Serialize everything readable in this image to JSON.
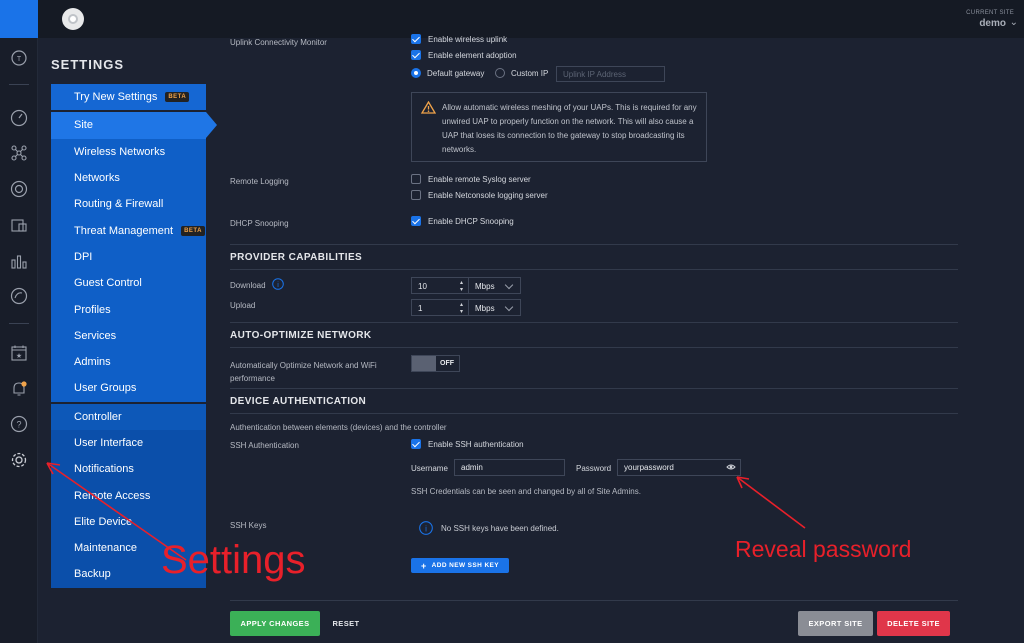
{
  "topbar": {
    "current_site_caption": "CURRENT SITE",
    "site_name": "demo"
  },
  "sidebar_title": "SETTINGS",
  "menu": {
    "try_new": {
      "label": "Try New Settings",
      "badge": "BETA"
    },
    "items": [
      {
        "label": "Site"
      },
      {
        "label": "Wireless Networks"
      },
      {
        "label": "Networks"
      },
      {
        "label": "Routing & Firewall"
      },
      {
        "label": "Threat Management",
        "badge": "BETA"
      },
      {
        "label": "DPI"
      },
      {
        "label": "Guest Control"
      },
      {
        "label": "Profiles"
      },
      {
        "label": "Services"
      },
      {
        "label": "Admins"
      },
      {
        "label": "User Groups"
      }
    ],
    "items2": [
      {
        "label": "Controller"
      },
      {
        "label": "User Interface"
      },
      {
        "label": "Notifications"
      },
      {
        "label": "Remote Access"
      },
      {
        "label": "Elite Device"
      },
      {
        "label": "Maintenance"
      },
      {
        "label": "Backup"
      }
    ]
  },
  "main": {
    "uplink_label": "Uplink Connectivity Monitor",
    "enable_wireless_uplink": "Enable wireless uplink",
    "enable_element_adoption": "Enable element adoption",
    "default_gateway": "Default gateway",
    "custom_ip": "Custom IP",
    "uplink_ip_placeholder": "Uplink IP Address",
    "mesh_warning": "Allow automatic wireless meshing of your UAPs. This is required for any unwired UAP to properly function on the network. This will also cause a UAP that loses its connection to the gateway to stop broadcasting its networks.",
    "remote_logging_label": "Remote Logging",
    "remote_syslog": "Enable remote Syslog server",
    "netconsole": "Enable Netconsole logging server",
    "dhcp_snooping_label": "DHCP Snooping",
    "enable_dhcp_snooping": "Enable DHCP Snooping",
    "provider_title": "PROVIDER CAPABILITIES",
    "download_label": "Download",
    "download_value": "10",
    "download_unit": "Mbps",
    "upload_label": "Upload",
    "upload_value": "1",
    "upload_unit": "Mbps",
    "auto_opt_title": "AUTO-OPTIMIZE NETWORK",
    "auto_opt_label": "Automatically Optimize Network and WiFi performance",
    "toggle_state": "OFF",
    "device_auth_title": "DEVICE AUTHENTICATION",
    "device_auth_sub": "Authentication between elements (devices) and the controller",
    "ssh_auth_label": "SSH Authentication",
    "enable_ssh": "Enable SSH authentication",
    "username_label": "Username",
    "username_value": "admin",
    "password_label": "Password",
    "password_value": "yourpassword",
    "ssh_note": "SSH Credentials can be seen and changed by all of Site Admins.",
    "ssh_keys_label": "SSH Keys",
    "no_ssh_keys": "No SSH keys have been defined.",
    "add_key_button": "ADD NEW SSH KEY",
    "apply_button": "APPLY CHANGES",
    "reset_button": "RESET",
    "export_button": "EXPORT SITE",
    "delete_button": "DELETE SITE"
  },
  "annotations": {
    "settings": "Settings",
    "reveal": "Reveal password"
  },
  "colors": {
    "accent": "#1a73e8",
    "apply": "#3bb057",
    "delete": "#e0364a",
    "annotation": "#e8202a"
  }
}
